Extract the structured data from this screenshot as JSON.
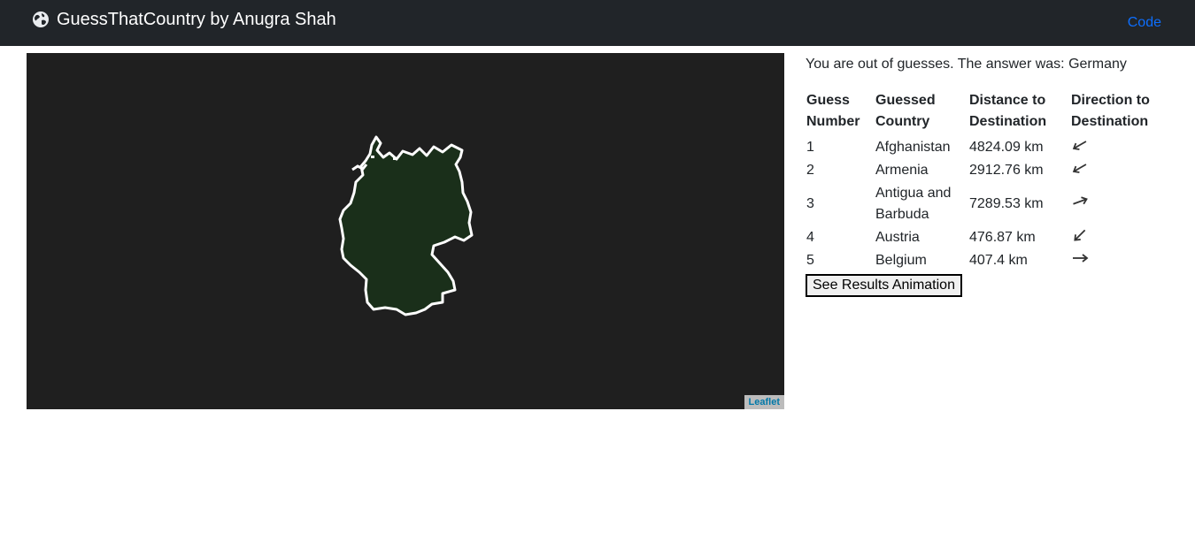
{
  "navbar": {
    "brand_icon": "globe-icon",
    "title": "GuessThatCountry by Anugra Shah",
    "code_link": "Code"
  },
  "map": {
    "attribution": "Leaflet",
    "country_fill": "#1a2f1a",
    "country_stroke": "#ffffff",
    "background": "#1f1f1f"
  },
  "status_text": "You are out of guesses. The answer was: Germany",
  "table": {
    "headers": [
      "Guess Number",
      "Guessed Country",
      "Distance to Destination",
      "Direction to Destination"
    ],
    "rows": [
      {
        "number": "1",
        "country": "Afghanistan",
        "distance": "4824.09 km",
        "direction": "arrow-up-left-shallow-icon",
        "angle": -30
      },
      {
        "number": "2",
        "country": "Armenia",
        "distance": "2912.76 km",
        "direction": "arrow-up-left-shallow-icon",
        "angle": -30
      },
      {
        "number": "3",
        "country": "Antigua and Barbuda",
        "distance": "7289.53 km",
        "direction": "arrow-up-right-shallow-icon",
        "angle": 160
      },
      {
        "number": "4",
        "country": "Austria",
        "distance": "476.87 km",
        "direction": "arrow-up-left-icon",
        "angle": -45
      },
      {
        "number": "5",
        "country": "Belgium",
        "distance": "407.4 km",
        "direction": "arrow-right-icon",
        "angle": 180
      }
    ]
  },
  "results_button": "See Results Animation"
}
